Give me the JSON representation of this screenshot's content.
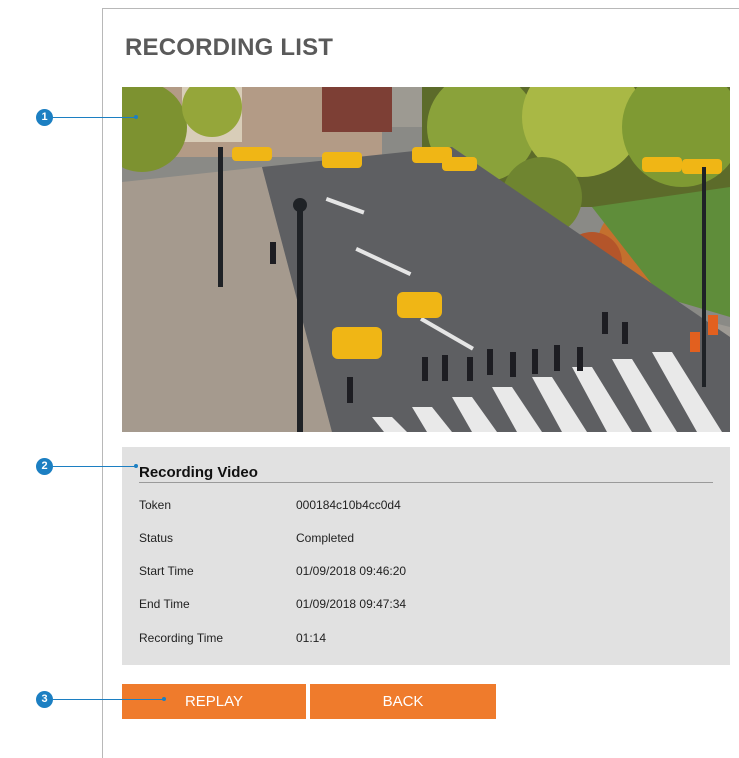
{
  "page": {
    "title": "RECORDING LIST"
  },
  "recording": {
    "heading": "Recording Video",
    "rows": [
      {
        "label": "Token",
        "value": "000184c10b4cc0d4"
      },
      {
        "label": "Status",
        "value": "Completed"
      },
      {
        "label": "Start Time",
        "value": "01/09/2018 09:46:20"
      },
      {
        "label": "End Time",
        "value": "01/09/2018 09:47:34"
      },
      {
        "label": "Recording Time",
        "value": "01:14"
      }
    ]
  },
  "buttons": {
    "replay": "REPLAY",
    "back": "BACK"
  },
  "callouts": [
    "1",
    "2",
    "3"
  ],
  "colors": {
    "accent": "#ef7b2c",
    "callout": "#1c7fc2",
    "panel": "#e1e1e1"
  }
}
